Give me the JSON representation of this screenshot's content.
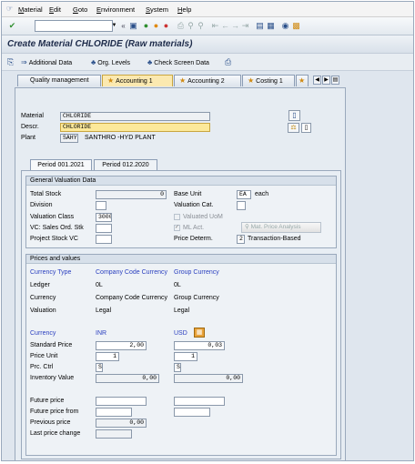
{
  "menubar": {
    "items": [
      "Material",
      "Edit",
      "Goto",
      "Environment",
      "System",
      "Help"
    ]
  },
  "title": "Create Material CHLORIDE (Raw materials)",
  "app_toolbar": {
    "additional_data": "Additional Data",
    "org_levels": "Org. Levels",
    "check_screen_data": "Check Screen Data"
  },
  "tabs": [
    {
      "label": "Quality management",
      "active": false
    },
    {
      "label": "Accounting 1",
      "active": true
    },
    {
      "label": "Accounting 2",
      "active": false
    },
    {
      "label": "Costing 1",
      "active": false
    }
  ],
  "header": {
    "material_label": "Material",
    "material_value": "CHLORIDE",
    "descr_label": "Descr.",
    "descr_value": "CHLORIDE",
    "plant_label": "Plant",
    "plant_code": "SAHY",
    "plant_name": "SANTHRO -HYD PLANT"
  },
  "period_tabs": [
    "Period 001.2021",
    "Period 012.2020"
  ],
  "general": {
    "title": "General Valuation Data",
    "total_stock_label": "Total Stock",
    "total_stock_value": "0",
    "base_unit_label": "Base Unit",
    "base_unit_value": "EA",
    "base_unit_text": "each",
    "division_label": "Division",
    "valuation_cat_label": "Valuation Cat.",
    "valuation_class_label": "Valuation Class",
    "valuation_class_value": "3000",
    "valuated_uom_label": "Valuated UoM",
    "vc_sales_label": "VC: Sales Ord. Stk",
    "ml_act_label": "ML Act.",
    "mat_price_btn": "Mat. Price Analysis",
    "project_stock_label": "Project Stock VC",
    "price_determ_label": "Price Determ.",
    "price_determ_value": "2",
    "price_determ_text": "Transaction-Based"
  },
  "prices": {
    "title": "Prices and values",
    "currency_type_label": "Currency Type",
    "col1_header": "Company Code Currency",
    "col2_header": "Group Currency",
    "ledger_label": "Ledger",
    "ledger_col1": "0L",
    "ledger_col2": "0L",
    "currency_label": "Currency",
    "currency_col1": "Company Code Currency",
    "currency_col2": "Group Currency",
    "valuation_label": "Valuation",
    "valuation_col1": "Legal",
    "valuation_col2": "Legal",
    "currency2_label": "Currency",
    "currency2_col1": "INR",
    "currency2_col2": "USD",
    "std_price_label": "Standard Price",
    "std_price_col1": "2,00",
    "std_price_col2": "0,03",
    "price_unit_label": "Price Unit",
    "price_unit_col1": "1",
    "price_unit_col2": "1",
    "prc_ctrl_label": "Prc. Ctrl",
    "prc_ctrl_col1": "S",
    "prc_ctrl_col2": "S",
    "inventory_label": "Inventory Value",
    "inventory_col1": "0,00",
    "inventory_col2": "0,00",
    "future_price_label": "Future price",
    "future_from_label": "Future price from",
    "previous_price_label": "Previous price",
    "previous_price_value": "0,00",
    "last_change_label": "Last price change"
  }
}
